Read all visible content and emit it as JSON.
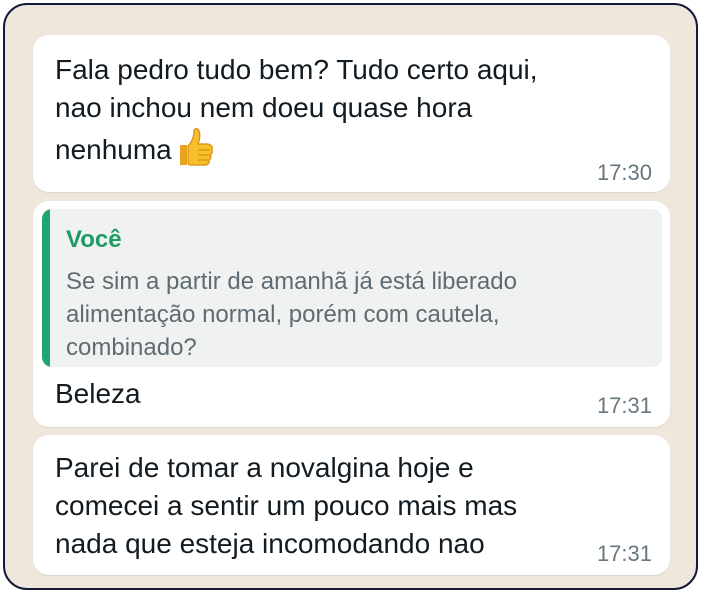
{
  "messages": [
    {
      "lines": "Fala pedro tudo bem? Tudo certo aqui,\nnao inchou nem doeu quase hora\nnenhuma",
      "emoji": "thumbs-up",
      "time": "17:30"
    },
    {
      "quote": {
        "author": "Você",
        "text": "Se sim a partir de amanhã já está liberado\nalimentação normal, porém com cautela,\ncombinado?"
      },
      "text": "Beleza",
      "time": "17:31"
    },
    {
      "lines": "Parei de tomar a novalgina hoje e\ncomecei a sentir um pouco mais mas\nnada que esteja incomodando nao",
      "time": "17:31"
    }
  ],
  "colors": {
    "background": "#efe7dc",
    "bubble": "#ffffff",
    "quote_accent": "#1ea672",
    "timestamp": "#667781"
  }
}
